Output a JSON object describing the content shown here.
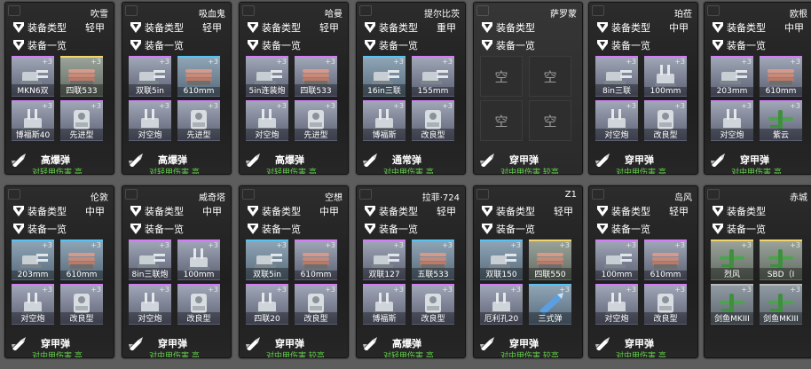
{
  "labels": {
    "armor_type": "装备类型",
    "equipment_list": "装备一览"
  },
  "colors": {
    "dmg_text": "#63d14a",
    "purple": "#d27cf5",
    "gold": "#f3d46a",
    "blue": "#58c3f2"
  },
  "cards": [
    {
      "name": "吹雪",
      "armor": "轻甲",
      "ammo_icon": "ammo-he-icon",
      "ammo": "高爆弹",
      "damage": "对轻甲伤害 高",
      "equip": [
        {
          "label": "MKN6双",
          "color": "purple",
          "level": "+3",
          "icon": "gun-icon"
        },
        {
          "label": "四联533",
          "color": "gold",
          "level": "+3",
          "icon": "torpedo-icon"
        },
        {
          "label": "博福斯40",
          "color": "purple",
          "level": "+3",
          "icon": "aa-gun-icon"
        },
        {
          "label": "先进型",
          "color": "purple",
          "level": "+3",
          "icon": "boiler-icon"
        }
      ]
    },
    {
      "name": "吸血鬼",
      "armor": "轻甲",
      "ammo_icon": "ammo-he-icon",
      "ammo": "高爆弹",
      "damage": "对轻甲伤害 高",
      "equip": [
        {
          "label": "双联5in",
          "color": "purple",
          "level": "+3",
          "icon": "gun-icon"
        },
        {
          "label": "610mm",
          "color": "blue",
          "level": "+3",
          "icon": "torpedo-icon"
        },
        {
          "label": "对空炮",
          "color": "purple",
          "level": "+3",
          "icon": "aa-gun-icon"
        },
        {
          "label": "先进型",
          "color": "purple",
          "level": "+3",
          "icon": "boiler-icon"
        }
      ]
    },
    {
      "name": "哈曼",
      "armor": "轻甲",
      "ammo_icon": "ammo-he-icon",
      "ammo": "高爆弹",
      "damage": "对轻甲伤害 高",
      "equip": [
        {
          "label": "5in连装炮",
          "color": "purple",
          "level": "+3",
          "icon": "gun-icon"
        },
        {
          "label": "四联533",
          "color": "purple",
          "level": "+3",
          "icon": "torpedo-icon"
        },
        {
          "label": "对空炮",
          "color": "purple",
          "level": "+3",
          "icon": "aa-gun-icon"
        },
        {
          "label": "先进型",
          "color": "purple",
          "level": "+3",
          "icon": "boiler-icon"
        }
      ]
    },
    {
      "name": "提尔比茨",
      "armor": "重甲",
      "ammo_icon": "ammo-normal-icon",
      "ammo": "通常弹",
      "damage": "对中甲伤害 高",
      "equip": [
        {
          "label": "16in三联",
          "color": "blue",
          "level": "+3",
          "icon": "gun-icon"
        },
        {
          "label": "155mm",
          "color": "purple",
          "level": "+3",
          "icon": "gun-icon"
        },
        {
          "label": "博福斯",
          "color": "purple",
          "level": "+3",
          "icon": "aa-gun-icon"
        },
        {
          "label": "改良型",
          "color": "purple",
          "level": "+3",
          "icon": "boiler-icon"
        }
      ]
    },
    {
      "name": "萨罗蒙",
      "armor": "",
      "empty": true,
      "ammo_icon": "ammo-ap-icon",
      "ammo": "穿甲弹",
      "damage": "对中甲伤害 较高",
      "empty_label": "空"
    },
    {
      "name": "珀莅",
      "armor": "中甲",
      "ammo_icon": "ammo-ap-icon",
      "ammo": "穿甲弹",
      "damage": "对中甲伤害 高",
      "equip": [
        {
          "label": "8in三联",
          "color": "purple",
          "level": "+3",
          "icon": "gun-icon"
        },
        {
          "label": "100mm",
          "color": "purple",
          "level": "+3",
          "icon": "aa-gun-icon"
        },
        {
          "label": "对空炮",
          "color": "purple",
          "level": "+3",
          "icon": "aa-gun-icon"
        },
        {
          "label": "改良型",
          "color": "purple",
          "level": "+3",
          "icon": "boiler-icon"
        }
      ]
    },
    {
      "name": "欧根",
      "armor": "中甲",
      "ammo_icon": "ammo-ap-icon",
      "ammo": "穿甲弹",
      "damage": "对中甲伤害 高",
      "equip": [
        {
          "label": "203mm",
          "color": "purple",
          "level": "+3",
          "icon": "gun-icon"
        },
        {
          "label": "610mm",
          "color": "purple",
          "level": "+3",
          "icon": "torpedo-icon"
        },
        {
          "label": "对空炮",
          "color": "purple",
          "level": "+3",
          "icon": "aa-gun-icon"
        },
        {
          "label": "紫云",
          "color": "purple",
          "level": "+3",
          "icon": "plane-icon"
        }
      ]
    },
    {
      "name": "伦敦",
      "armor": "中甲",
      "ammo_icon": "ammo-ap-icon",
      "ammo": "穿甲弹",
      "damage": "对中甲伤害 高",
      "equip": [
        {
          "label": "203mm",
          "color": "blue",
          "level": "+3",
          "icon": "gun-icon"
        },
        {
          "label": "610mm",
          "color": "blue",
          "level": "+3",
          "icon": "torpedo-icon"
        },
        {
          "label": "对空炮",
          "color": "purple",
          "level": "+3",
          "icon": "aa-gun-icon"
        },
        {
          "label": "改良型",
          "color": "purple",
          "level": "+3",
          "icon": "boiler-icon"
        }
      ]
    },
    {
      "name": "威奇塔",
      "armor": "中甲",
      "ammo_icon": "ammo-ap-icon",
      "ammo": "穿甲弹",
      "damage": "对中甲伤害 高",
      "equip": [
        {
          "label": "8in三联炮",
          "color": "purple",
          "level": "+3",
          "icon": "gun-icon"
        },
        {
          "label": "100mm",
          "color": "purple",
          "level": "+3",
          "icon": "aa-gun-icon"
        },
        {
          "label": "对空炮",
          "color": "purple",
          "level": "+3",
          "icon": "aa-gun-icon"
        },
        {
          "label": "改良型",
          "color": "purple",
          "level": "+3",
          "icon": "boiler-icon"
        }
      ]
    },
    {
      "name": "空想",
      "armor": "中甲",
      "ammo_icon": "ammo-ap-icon",
      "ammo": "穿甲弹",
      "damage": "对中甲伤害 较高",
      "equip": [
        {
          "label": "双联5in",
          "color": "blue",
          "level": "+3",
          "icon": "gun-icon"
        },
        {
          "label": "610mm",
          "color": "purple",
          "level": "+3",
          "icon": "torpedo-icon"
        },
        {
          "label": "四联20",
          "color": "purple",
          "level": "+3",
          "icon": "aa-gun-icon"
        },
        {
          "label": "改良型",
          "color": "purple",
          "level": "+3",
          "icon": "boiler-icon"
        }
      ]
    },
    {
      "name": "拉菲·724",
      "armor": "轻甲",
      "ammo_icon": "ammo-he-icon",
      "ammo": "高爆弹",
      "damage": "对轻甲伤害 高",
      "equip": [
        {
          "label": "双联127",
          "color": "purple",
          "level": "+3",
          "icon": "gun-icon"
        },
        {
          "label": "五联533",
          "color": "blue",
          "level": "+3",
          "icon": "torpedo-icon"
        },
        {
          "label": "博福斯",
          "color": "purple",
          "level": "+3",
          "icon": "aa-gun-icon"
        },
        {
          "label": "改良型",
          "color": "purple",
          "level": "+3",
          "icon": "boiler-icon"
        }
      ]
    },
    {
      "name": "Z1",
      "armor": "轻甲",
      "ammo_icon": "ammo-ap-icon",
      "ammo": "穿甲弹",
      "damage": "对中甲伤害 较高",
      "equip": [
        {
          "label": "双联150",
          "color": "blue",
          "level": "+3",
          "icon": "gun-icon"
        },
        {
          "label": "四联550",
          "color": "gold",
          "level": "+3",
          "icon": "torpedo-icon"
        },
        {
          "label": "厄利孔20",
          "color": "purple",
          "level": "+3",
          "icon": "aa-gun-icon"
        },
        {
          "label": "三式弹",
          "color": "blue",
          "level": "+3",
          "icon": "shell-icon"
        }
      ]
    },
    {
      "name": "岛风",
      "armor": "轻甲",
      "ammo_icon": "ammo-ap-icon",
      "ammo": "穿甲弹",
      "damage": "对中甲伤害 高",
      "equip": [
        {
          "label": "100mm",
          "color": "purple",
          "level": "+3",
          "icon": "gun-icon"
        },
        {
          "label": "610mm",
          "color": "purple",
          "level": "+3",
          "icon": "torpedo-icon"
        },
        {
          "label": "对空炮",
          "color": "purple",
          "level": "+3",
          "icon": "aa-gun-icon"
        },
        {
          "label": "改良型",
          "color": "purple",
          "level": "+3",
          "icon": "boiler-icon"
        }
      ]
    },
    {
      "name": "赤城",
      "armor": "",
      "ammo_icon": "",
      "ammo": "",
      "damage": "",
      "equip": [
        {
          "label": "烈风",
          "color": "gold",
          "level": "+3",
          "icon": "plane-icon"
        },
        {
          "label": "SBD（I",
          "color": "gold",
          "level": "+3",
          "icon": "plane-icon"
        },
        {
          "label": "剑鱼MKIII",
          "color": "gray",
          "level": "+3",
          "icon": "plane-icon"
        },
        {
          "label": "剑鱼MKIII",
          "color": "gray",
          "level": "+3",
          "icon": "plane-icon"
        }
      ]
    }
  ]
}
